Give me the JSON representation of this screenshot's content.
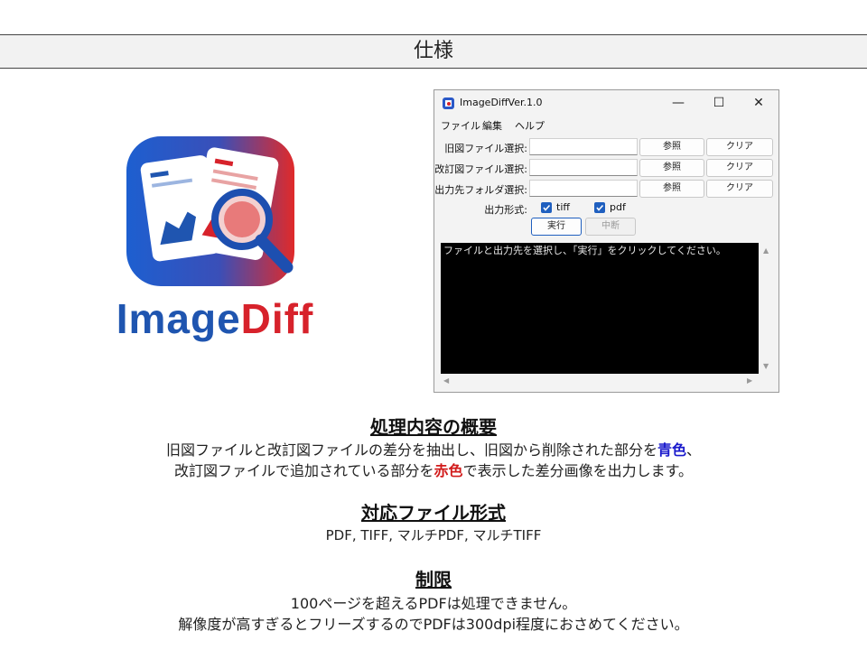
{
  "slide_title": "仕様",
  "logo": {
    "word_part1": "Image",
    "word_part2": "Diff"
  },
  "app": {
    "window_title": "ImageDiffVer.1.0",
    "controls": {
      "minimize": "—",
      "maximize": "☐",
      "close": "✕"
    },
    "menu": [
      "ファイル",
      "編集",
      "ヘルプ"
    ],
    "rows": [
      {
        "label": "旧図ファイル選択:",
        "value": "",
        "browse": "参照",
        "clear": "クリア"
      },
      {
        "label": "改訂図ファイル選択:",
        "value": "",
        "browse": "参照",
        "clear": "クリア"
      },
      {
        "label": "出力先フォルダ選択:",
        "value": "",
        "browse": "参照",
        "clear": "クリア"
      }
    ],
    "format_label": "出力形式:",
    "formats": [
      {
        "label": "tiff",
        "checked": true
      },
      {
        "label": "pdf",
        "checked": true
      }
    ],
    "run_button": "実行",
    "stop_button": "中断",
    "console_text": "ファイルと出力先を選択し、「実行」をクリックしてください。"
  },
  "overview": {
    "heading": "処理内容の概要",
    "line1_pre": "旧図ファイルと改訂図ファイルの差分を抽出し、旧図から削除された部分を",
    "line1_color": "青色",
    "line1_post": "、",
    "line2_pre": "改訂図ファイルで追加されている部分を",
    "line2_color": "赤色",
    "line2_post": "で表示した差分画像を出力します。"
  },
  "formats_section": {
    "heading": "対応ファイル形式",
    "text": "PDF, TIFF, マルチPDF, マルチTIFF"
  },
  "limits": {
    "heading": "制限",
    "line1": "100ページを超えるPDFは処理できません。",
    "line2": "解像度が高すぎるとフリーズするのでPDFは300dpi程度におさめてください。"
  },
  "colors": {
    "accent_blue": "#1a1acc",
    "accent_red": "#d11b1b",
    "logo_blue": "#1f55b0",
    "logo_red": "#d7222b",
    "checkbox": "#1f5fbf"
  }
}
